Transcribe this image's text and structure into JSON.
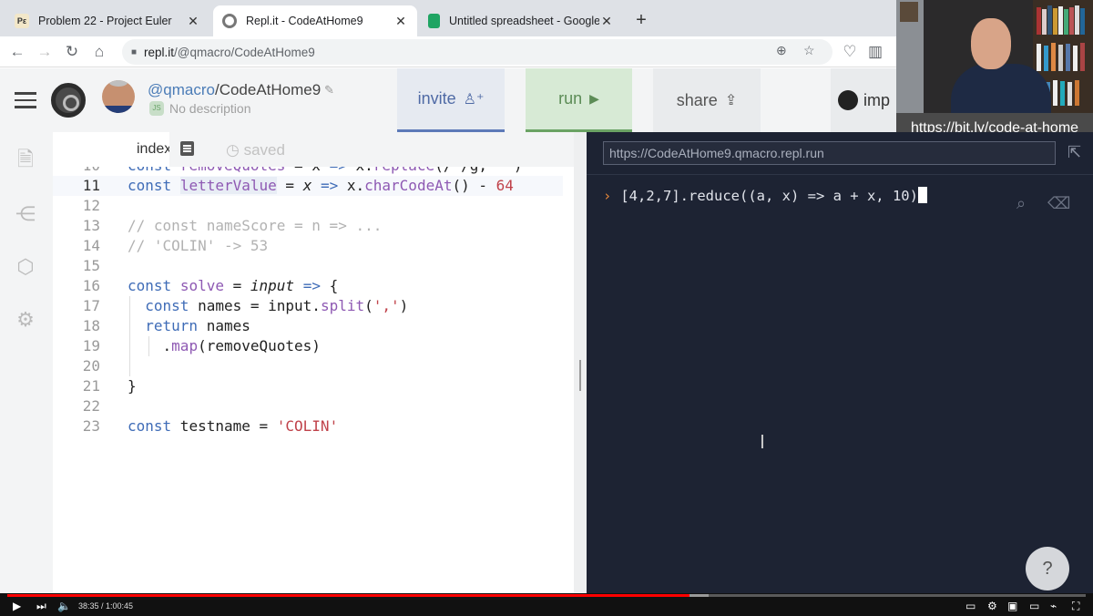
{
  "browser": {
    "tabs": [
      {
        "title": "Problem 22 - Project Euler",
        "favicon_color": "#f2e7c9"
      },
      {
        "title": "Repl.it - CodeAtHome9",
        "favicon_color": "#777777"
      },
      {
        "title": "Untitled spreadsheet - Google Sh",
        "favicon_color": "#1fa463"
      }
    ],
    "close_glyph": "✕",
    "new_tab_glyph": "+",
    "address": {
      "host": "repl.it",
      "path": "/@qmacro/CodeAtHome9"
    }
  },
  "webcam": {
    "link_text": "https://bit.ly/code-at-home"
  },
  "repl": {
    "owner": "@qmacro",
    "separator": "/",
    "project": "CodeAtHome9",
    "description": "No description",
    "invite_label": "invite",
    "run_label": "run",
    "share_label": "share",
    "import_label": "imp",
    "file_name": "index.js",
    "save_status": "saved"
  },
  "editor": {
    "lines": [
      {
        "n": "10",
        "text": "const removeQuotes = x => x.replace(/\"/g, '')"
      },
      {
        "n": "11",
        "text": "const letterValue = x => x.charCodeAt() - 64"
      },
      {
        "n": "12",
        "text": ""
      },
      {
        "n": "13",
        "text": "// const nameScore = n => ..."
      },
      {
        "n": "14",
        "text": "// 'COLIN' -> 53"
      },
      {
        "n": "15",
        "text": ""
      },
      {
        "n": "16",
        "text": "const solve = input => {"
      },
      {
        "n": "17",
        "text": "  const names = input.split(',')"
      },
      {
        "n": "18",
        "text": "  return names"
      },
      {
        "n": "19",
        "text": "    .map(removeQuotes)"
      },
      {
        "n": "20",
        "text": ""
      },
      {
        "n": "21",
        "text": "}"
      },
      {
        "n": "22",
        "text": ""
      },
      {
        "n": "23",
        "text": "const testname = 'COLIN'"
      }
    ],
    "current_line": "11"
  },
  "console": {
    "url": "https://CodeAtHome9.qmacro.repl.run",
    "prompt_glyph": "›",
    "input": "[4,2,7].reduce((a, x) => a + x, 10)"
  },
  "help_label": "?",
  "video": {
    "time": "38:35 / 1:00:45",
    "progress": 0.633,
    "buffered": 0.65
  }
}
